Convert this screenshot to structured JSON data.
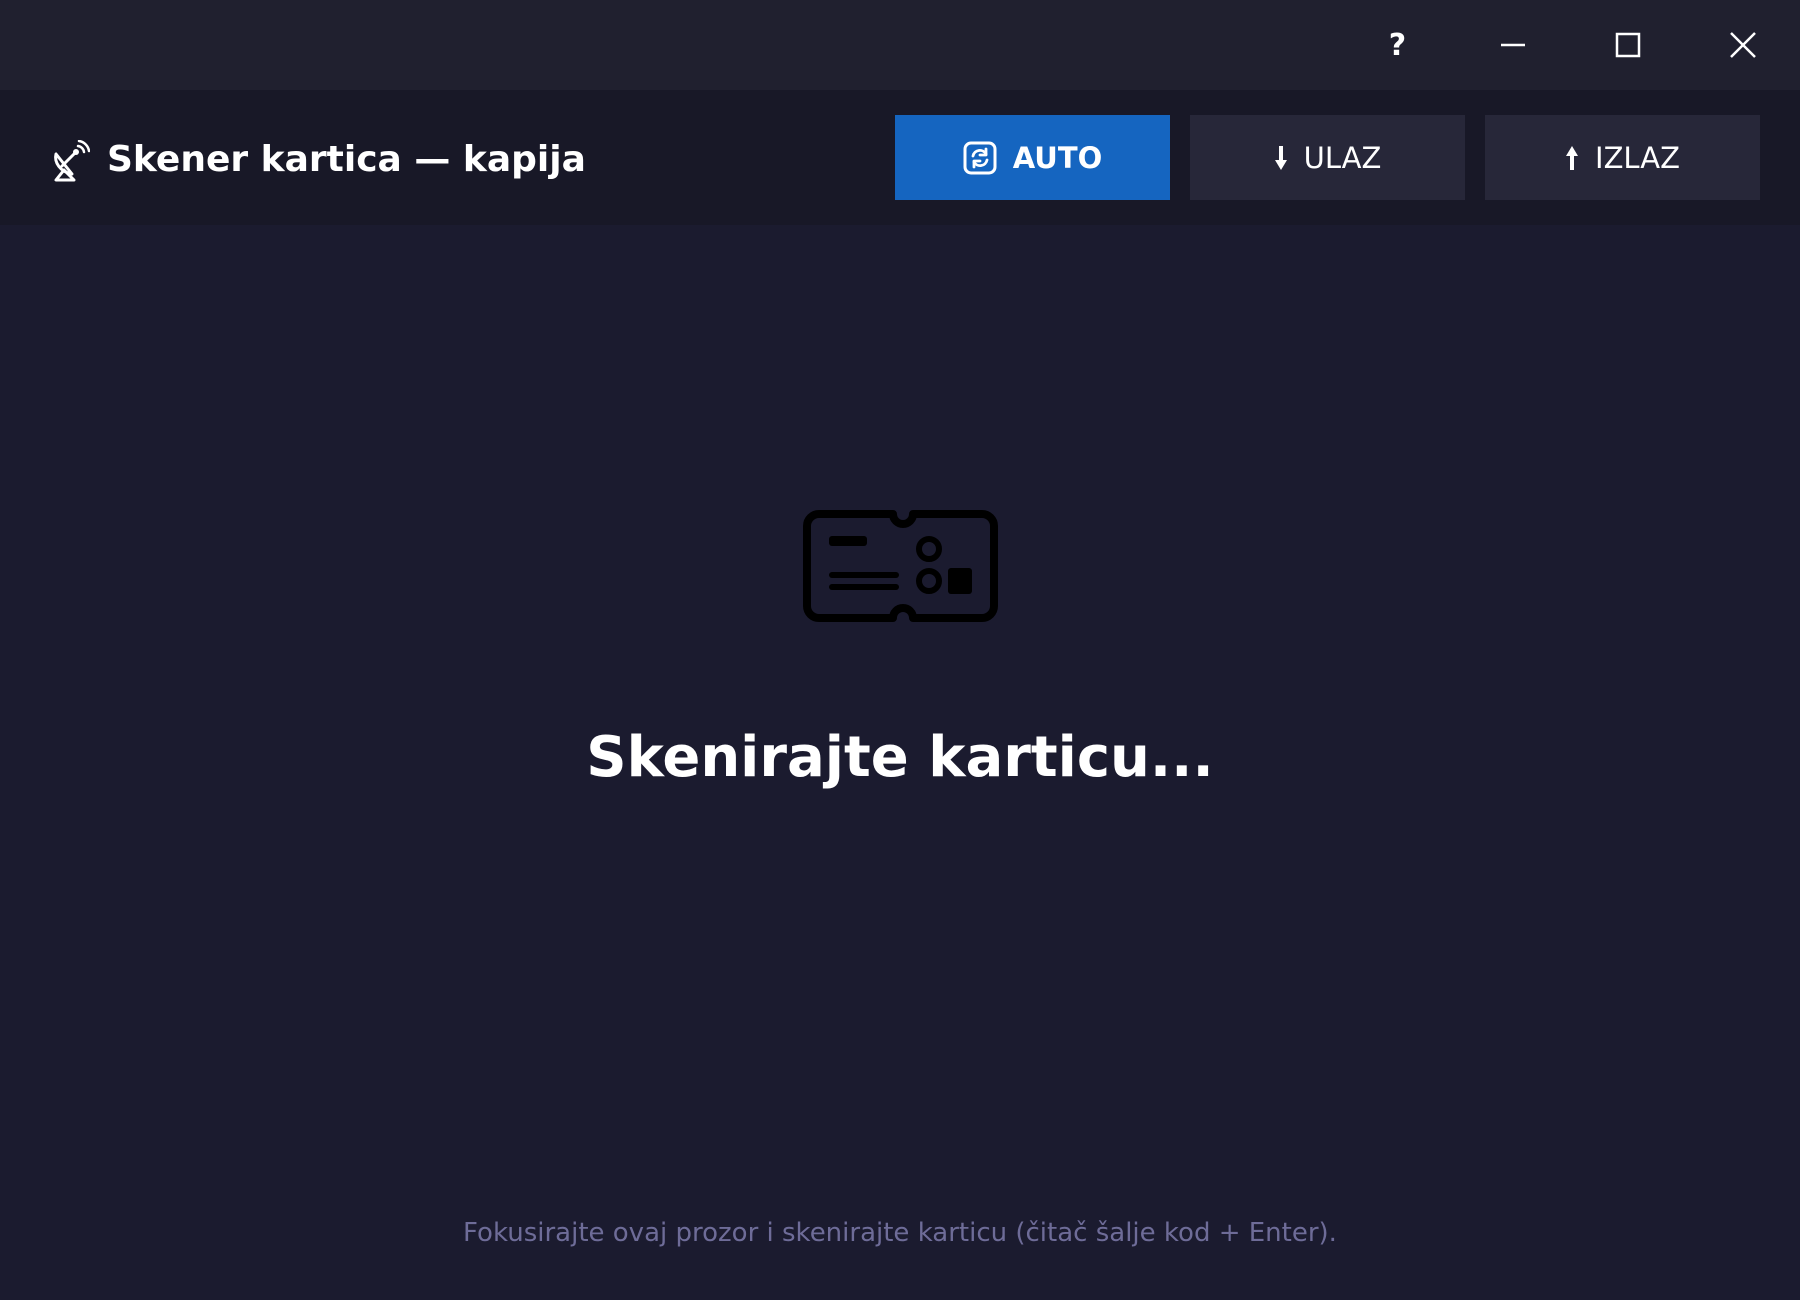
{
  "titlebar": {
    "help_label": "?",
    "buttons": [
      "help-icon",
      "minimize-icon",
      "maximize-icon",
      "close-icon"
    ]
  },
  "header": {
    "app_icon": "satellite-dish-icon",
    "title": "Skener kartica — kapija",
    "modes": [
      {
        "label": "AUTO",
        "icon": "sync-icon",
        "active": true
      },
      {
        "label": "ULAZ",
        "icon": "arrow-down-icon",
        "arrow": "⬇",
        "active": false
      },
      {
        "label": "IZLAZ",
        "icon": "arrow-up-icon",
        "arrow": "⬆",
        "active": false
      }
    ]
  },
  "main": {
    "icon": "id-card-icon",
    "prompt": "Skenirajte karticu...",
    "hint": "Fokusirajte ovaj prozor i skenirajte karticu (čitač šalje kod + Enter)."
  },
  "colors": {
    "background": "#1b1b2f",
    "titlebar": "#20202f",
    "header": "#181827",
    "accent": "#1565c0",
    "button_inactive": "#272739",
    "hint_text": "#6e6c98"
  }
}
